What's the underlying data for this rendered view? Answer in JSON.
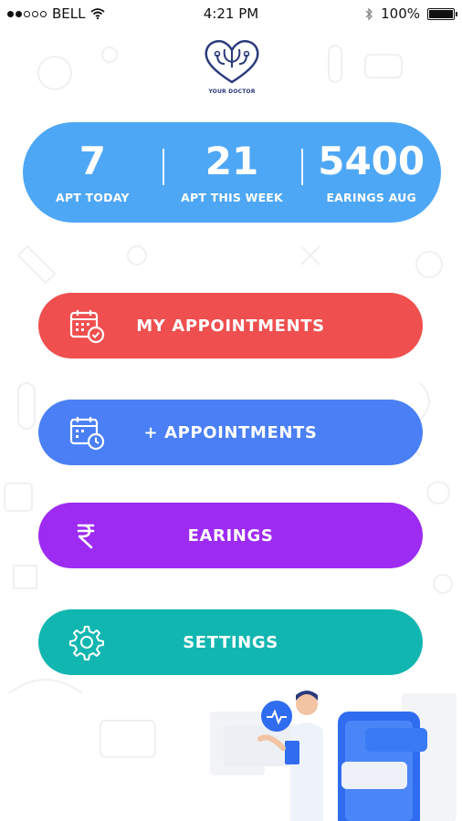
{
  "status_bar": {
    "carrier": "BELL",
    "time": "4:21 PM",
    "battery": "100%",
    "battery_level": 1.0
  },
  "logo": {
    "caption": "YOUR DOCTOR"
  },
  "stats": [
    {
      "value": "7",
      "label": "APT TODAY"
    },
    {
      "value": "21",
      "label": "APT THIS WEEK"
    },
    {
      "value": "5400",
      "label": "EARINGS AUG"
    }
  ],
  "menu": {
    "my_appointments": {
      "label": "MY APPOINTMENTS",
      "icon": "calendar-check-icon",
      "color": "#ef4f4f"
    },
    "add_appointments": {
      "label": "+ APPOINTMENTS",
      "icon": "calendar-clock-icon",
      "color": "#4a7ff5"
    },
    "earnings": {
      "label": "EARINGS",
      "icon": "rupee-icon",
      "color": "#9d2bf2"
    },
    "settings": {
      "label": "SETTINGS",
      "icon": "gear-icon",
      "color": "#12b6b0"
    }
  },
  "colors": {
    "stats_card": "#4ea7f5"
  }
}
